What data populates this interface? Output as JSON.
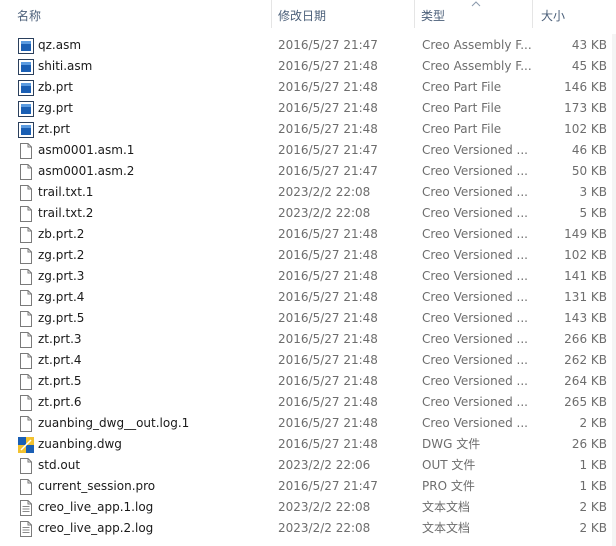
{
  "columns": {
    "name": "名称",
    "date": "修改日期",
    "type": "类型",
    "size": "大小"
  },
  "sort": {
    "column": "type",
    "direction": "ascending",
    "icon": "chevron-up-icon"
  },
  "files": [
    {
      "name": "qz.asm",
      "date": "2016/5/27 21:47",
      "type": "Creo Assembly F...",
      "size": "43 KB",
      "icon": "creo-model-icon"
    },
    {
      "name": "shiti.asm",
      "date": "2016/5/27 21:48",
      "type": "Creo Assembly F...",
      "size": "45 KB",
      "icon": "creo-model-icon"
    },
    {
      "name": "zb.prt",
      "date": "2016/5/27 21:48",
      "type": "Creo Part File",
      "size": "146 KB",
      "icon": "creo-model-icon"
    },
    {
      "name": "zg.prt",
      "date": "2016/5/27 21:48",
      "type": "Creo Part File",
      "size": "173 KB",
      "icon": "creo-model-icon"
    },
    {
      "name": "zt.prt",
      "date": "2016/5/27 21:48",
      "type": "Creo Part File",
      "size": "102 KB",
      "icon": "creo-model-icon"
    },
    {
      "name": "asm0001.asm.1",
      "date": "2016/5/27 21:47",
      "type": "Creo Versioned ...",
      "size": "46 KB",
      "icon": "blank-file-icon"
    },
    {
      "name": "asm0001.asm.2",
      "date": "2016/5/27 21:47",
      "type": "Creo Versioned ...",
      "size": "50 KB",
      "icon": "blank-file-icon"
    },
    {
      "name": "trail.txt.1",
      "date": "2023/2/2 22:08",
      "type": "Creo Versioned ...",
      "size": "3 KB",
      "icon": "blank-file-icon"
    },
    {
      "name": "trail.txt.2",
      "date": "2023/2/2 22:08",
      "type": "Creo Versioned ...",
      "size": "5 KB",
      "icon": "blank-file-icon"
    },
    {
      "name": "zb.prt.2",
      "date": "2016/5/27 21:48",
      "type": "Creo Versioned ...",
      "size": "149 KB",
      "icon": "blank-file-icon"
    },
    {
      "name": "zg.prt.2",
      "date": "2016/5/27 21:48",
      "type": "Creo Versioned ...",
      "size": "102 KB",
      "icon": "blank-file-icon"
    },
    {
      "name": "zg.prt.3",
      "date": "2016/5/27 21:48",
      "type": "Creo Versioned ...",
      "size": "141 KB",
      "icon": "blank-file-icon"
    },
    {
      "name": "zg.prt.4",
      "date": "2016/5/27 21:48",
      "type": "Creo Versioned ...",
      "size": "131 KB",
      "icon": "blank-file-icon"
    },
    {
      "name": "zg.prt.5",
      "date": "2016/5/27 21:48",
      "type": "Creo Versioned ...",
      "size": "143 KB",
      "icon": "blank-file-icon"
    },
    {
      "name": "zt.prt.3",
      "date": "2016/5/27 21:48",
      "type": "Creo Versioned ...",
      "size": "266 KB",
      "icon": "blank-file-icon"
    },
    {
      "name": "zt.prt.4",
      "date": "2016/5/27 21:48",
      "type": "Creo Versioned ...",
      "size": "262 KB",
      "icon": "blank-file-icon"
    },
    {
      "name": "zt.prt.5",
      "date": "2016/5/27 21:48",
      "type": "Creo Versioned ...",
      "size": "264 KB",
      "icon": "blank-file-icon"
    },
    {
      "name": "zt.prt.6",
      "date": "2016/5/27 21:48",
      "type": "Creo Versioned ...",
      "size": "265 KB",
      "icon": "blank-file-icon"
    },
    {
      "name": "zuanbing_dwg__out.log.1",
      "date": "2016/5/27 21:48",
      "type": "Creo Versioned ...",
      "size": "2 KB",
      "icon": "blank-file-icon"
    },
    {
      "name": "zuanbing.dwg",
      "date": "2016/5/27 21:48",
      "type": "DWG 文件",
      "size": "26 KB",
      "icon": "creo-drawing-icon"
    },
    {
      "name": "std.out",
      "date": "2023/2/2 22:06",
      "type": "OUT 文件",
      "size": "1 KB",
      "icon": "blank-file-icon"
    },
    {
      "name": "current_session.pro",
      "date": "2016/5/27 21:47",
      "type": "PRO 文件",
      "size": "1 KB",
      "icon": "blank-file-icon"
    },
    {
      "name": "creo_live_app.1.log",
      "date": "2023/2/2 22:08",
      "type": "文本文档",
      "size": "2 KB",
      "icon": "text-file-icon"
    },
    {
      "name": "creo_live_app.2.log",
      "date": "2023/2/2 22:08",
      "type": "文本文档",
      "size": "2 KB",
      "icon": "text-file-icon"
    }
  ],
  "colors": {
    "header_text": "#4c607a",
    "name_text": "#1a1a1a",
    "detail_text": "#6d6d6d",
    "creo_blue": "#1a5fb4"
  }
}
